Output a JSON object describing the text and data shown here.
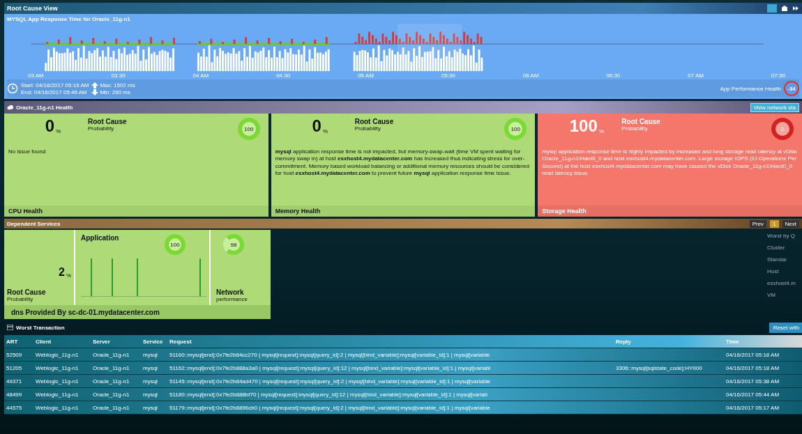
{
  "window": {
    "title": "Root Cause View"
  },
  "chart": {
    "title": "MYSQL App Response Time for Oracle_11g-n1",
    "x_labels": [
      "03 AM",
      "03:30",
      "04 AM",
      "04:30",
      "05 AM",
      "05:30",
      "06 AM",
      "06:30",
      "07 AM",
      "07:30"
    ]
  },
  "time_range": {
    "start": "Start: 04/16/2017 05:16 AM",
    "end": "End: 04/16/2017 05:46 AM",
    "max": "Max: 1502 ms",
    "min": "Min: 260 ms"
  },
  "app_health": {
    "label": "App Performance Health",
    "value": "-34"
  },
  "health": {
    "title": "Oracle_11g-n1 Health",
    "button": "View network sta",
    "cards": [
      {
        "kind": "ok",
        "value": "0",
        "unit": "%",
        "heading": "Root Cause",
        "subheading": "Probability",
        "score": "100",
        "text": "No issue found",
        "name": "CPU Health"
      },
      {
        "kind": "ok",
        "value": "0",
        "unit": "%",
        "heading": "Root Cause",
        "subheading": "Probability",
        "score": "100",
        "text": "**mysql** application response time is not impacted, but memory-swap-wait (time VM spent waiting for memory swap in) at host **esxhost4.mydatacenter.com** has increased thus indicating stress for over-commitment. Memory based workload balancing or additional memory resources should be considered for host **esxhost4.mydatacenter.com** to prevent future **mysql** application response time issue.",
        "name": "Memory Health"
      },
      {
        "kind": "critical",
        "value": "100",
        "unit": "%",
        "heading": "Root Cause",
        "subheading": "Probability",
        "score": "0",
        "text": "mysql application response time is highly impacted by increased and long storage read latency at vDisk Oracle_11g-n1\\Hard0_0 and host esxhost4.mydatacenter.com. Large storage IOPS (IO Operations Per Second) at the host esxhost4.mydatacenter.com may have caused the vDisk Oracle_11g-n1\\Hard0_0 read latency issue.",
        "name": "Storage Health"
      }
    ]
  },
  "dependent": {
    "title": "Dependent Services",
    "pager": [
      "Prev",
      "1",
      "Next"
    ],
    "card": {
      "value": "2",
      "unit": "%",
      "label": "Root Cause",
      "sublabel": "Probability",
      "app_title": "Application",
      "app_score": "100",
      "net_score": "98",
      "net_title": "Network",
      "net_sub": "performance",
      "footer": "dns Provided By sc-dc-01.mydatacenter.com"
    },
    "side": [
      "Worst by Q",
      "Cluster",
      "Standar",
      "Host",
      "esxhost4.m",
      "VM"
    ]
  },
  "worst": {
    "title": "Worst Transaction",
    "button": "Reset with",
    "columns": [
      "ART",
      "Client",
      "Server",
      "Service",
      "Request",
      "Reply",
      "Time"
    ],
    "rows": [
      [
        "52509",
        "Weblogic_11g-n1",
        "Oracle_11g-n1",
        "mysql",
        "51160::mysql[end]:0x7fe2b84cc270 | mysql[request]:mysql[query_id]:2 | mysql[bind_variable]:mysql[variable_id]:1 | mysql[variable",
        "",
        "04/16/2017 05:18 AM"
      ],
      [
        "51205",
        "Weblogic_11g-n1",
        "Oracle_11g-n1",
        "mysql",
        "51162::mysql[end]:0x7fe2b888a3a0 | mysql[request]:mysql[query_id]:12 | mysql[bind_variable]:mysql[variable_id]:1 | mysql[variabl",
        "3306::mysql[sqlstate_code]:HY000",
        "04/16/2017 05:18 AM"
      ],
      [
        "49371",
        "Weblogic_11g-n1",
        "Oracle_11g-n1",
        "mysql",
        "51145::mysql[end]:0x7fe2b84ad470 | mysql[request]:mysql[query_id]:2 | mysql[bind_variable]:mysql[variable_id]:1 | mysql[variable",
        "",
        "04/16/2017 05:38 AM"
      ],
      [
        "48499",
        "Weblogic_11g-n1",
        "Oracle_11g-n1",
        "mysql",
        "51180::mysql[end]:0x7fe2b888bf70 | mysql[request]:mysql[query_id]:12 | mysql[bind_variable]:mysql[variable_id]:1 | mysql[variab",
        "",
        "04/16/2017 05:44 AM"
      ],
      [
        "44575",
        "Weblogic_11g-n1",
        "Oracle_11g-n1",
        "mysql",
        "51179::mysql[end]:0x7fe2b8896cb0 | mysql[request]:mysql[query_id]:2 | mysql[bind_variable]:mysql[variable_id]:1 | mysql[variable",
        "",
        "04/16/2017 05:17 AM"
      ]
    ]
  }
}
